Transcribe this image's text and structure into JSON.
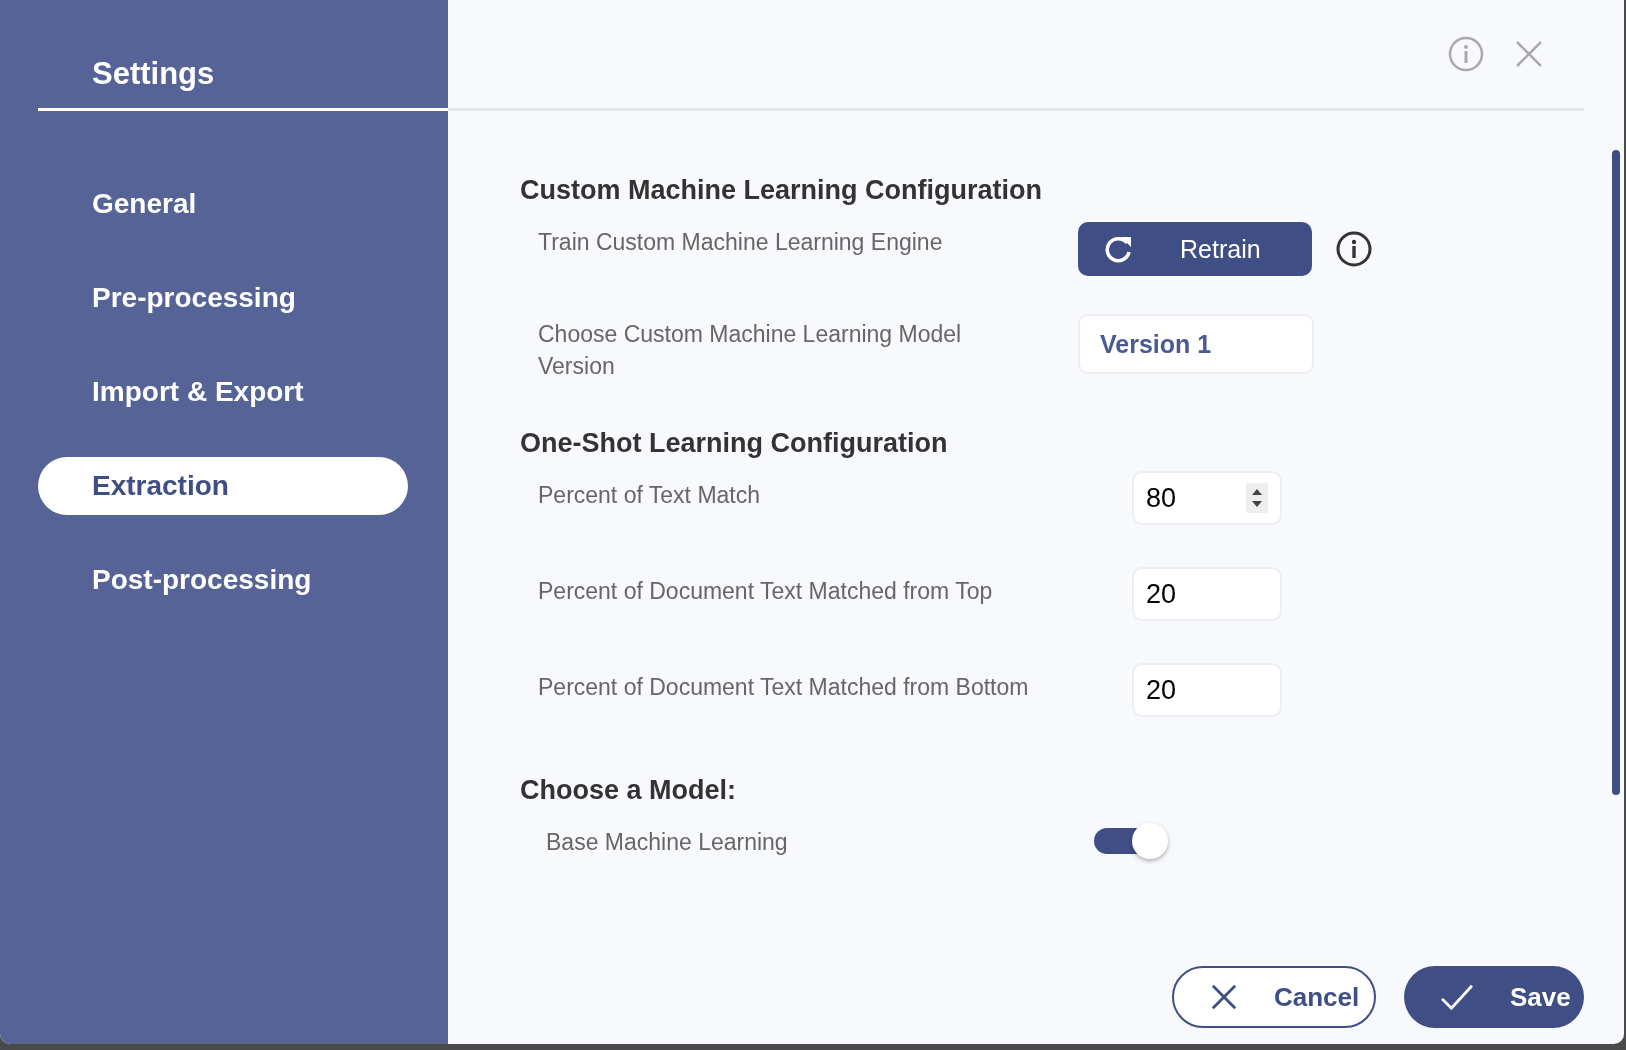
{
  "sidebar": {
    "title": "Settings",
    "items": [
      {
        "label": "General",
        "selected": false
      },
      {
        "label": "Pre-processing",
        "selected": false
      },
      {
        "label": "Import & Export",
        "selected": false
      },
      {
        "label": "Extraction",
        "selected": true
      },
      {
        "label": "Post-processing",
        "selected": false
      }
    ]
  },
  "sections": [
    {
      "heading": "Custom Machine Learning Configuration",
      "rows": [
        {
          "kind": "button",
          "label": "Train Custom Machine Learning Engine",
          "button": "Retrain"
        },
        {
          "kind": "select",
          "label": "Choose Custom Machine Learning Model Version",
          "value": "Version 1"
        }
      ]
    },
    {
      "heading": "One-Shot Learning Configuration",
      "rows": [
        {
          "kind": "spinner",
          "label": "Percent of Text Match",
          "value": "80"
        },
        {
          "kind": "number",
          "label": "Percent of Document Text Matched from Top",
          "value": "20"
        },
        {
          "kind": "number",
          "label": "Percent of Document Text Matched from Bottom",
          "value": "20"
        }
      ]
    },
    {
      "heading": "Choose a Model:",
      "rows": [
        {
          "kind": "toggle",
          "label": "Base Machine Learning",
          "on": true
        }
      ]
    }
  ],
  "footer": {
    "cancel": "Cancel",
    "save": "Save"
  }
}
